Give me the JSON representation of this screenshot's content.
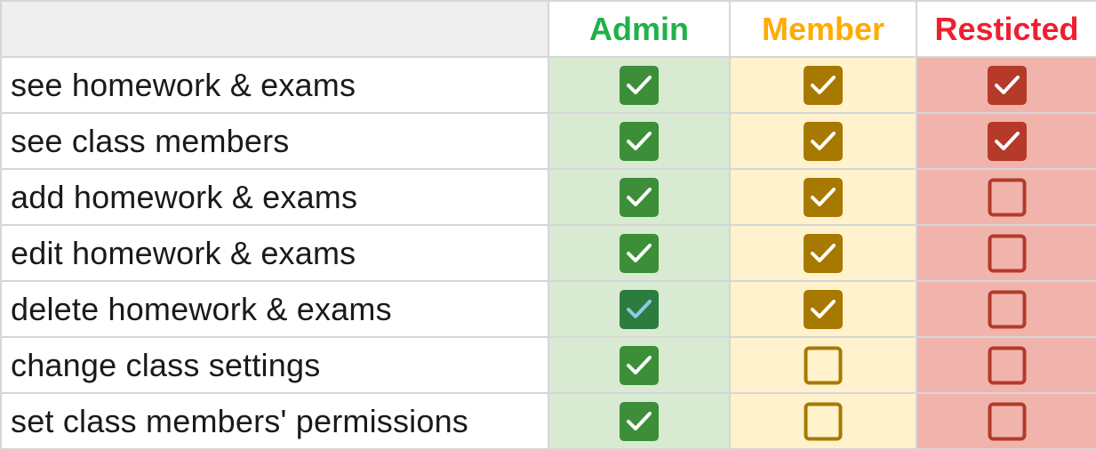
{
  "colors": {
    "admin": "#1fb14a",
    "member": "#ffab00",
    "restricted": "#ef1f30",
    "admin_check": "#3c8f38",
    "admin_check_selected": "#2b7c3d",
    "admin_check_tick_selected": "#8ecae6",
    "member_check": "#a77900",
    "restricted_check": "#b53a2a",
    "admin_bg": "#d9ead3",
    "member_bg": "#fff2cc",
    "restricted_bg": "#f0b4ad"
  },
  "header": {
    "permission_label": "",
    "roles": [
      {
        "key": "admin",
        "label": "Admin"
      },
      {
        "key": "member",
        "label": "Member"
      },
      {
        "key": "restricted",
        "label": "Resticted"
      }
    ]
  },
  "rows": [
    {
      "permission": "see homework & exams",
      "admin": true,
      "member": true,
      "restricted": true
    },
    {
      "permission": "see class members",
      "admin": true,
      "member": true,
      "restricted": true
    },
    {
      "permission": "add homework & exams",
      "admin": true,
      "member": true,
      "restricted": false
    },
    {
      "permission": "edit homework & exams",
      "admin": true,
      "member": true,
      "restricted": false
    },
    {
      "permission": "delete homework & exams",
      "admin": true,
      "member": true,
      "restricted": false,
      "admin_selected": true
    },
    {
      "permission": "change class settings",
      "admin": true,
      "member": false,
      "restricted": false
    },
    {
      "permission": "set class members' permissions",
      "admin": true,
      "member": false,
      "restricted": false
    }
  ]
}
